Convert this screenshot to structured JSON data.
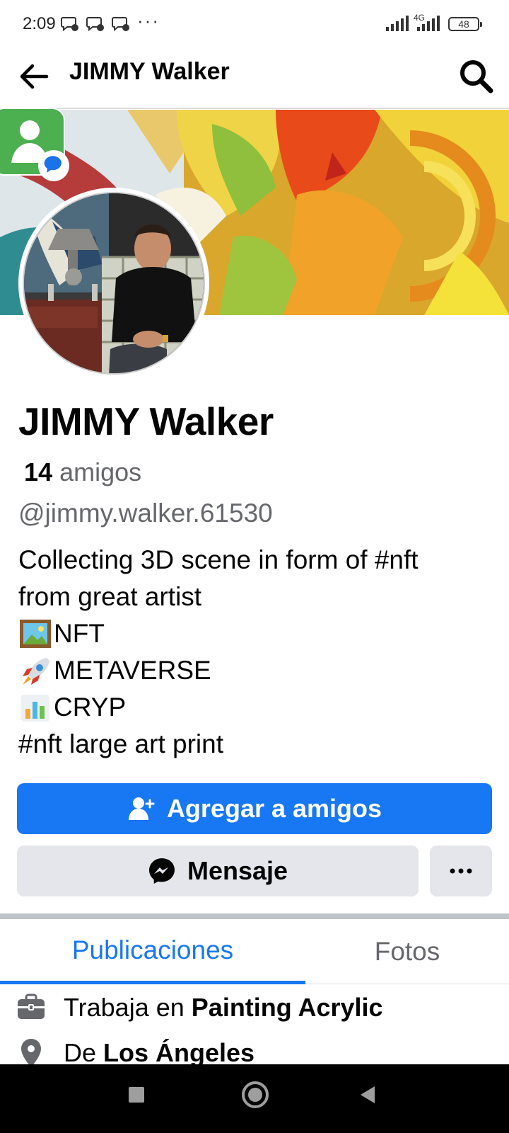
{
  "status_bar": {
    "time": "2:09",
    "dots": "···",
    "network": "4G",
    "battery": "48"
  },
  "header": {
    "title": "JIMMY Walker"
  },
  "profile": {
    "name": "JIMMY Walker",
    "friends_count": "14",
    "friends_label": "amigos",
    "username": "@jimmy.walker.61530",
    "bio": [
      {
        "emoji": "framed-picture-icon",
        "text": "Collecting 3D scene in form of #nft"
      },
      {
        "emoji": "",
        "text": "from great artist"
      },
      {
        "emoji": "framed-picture-icon",
        "text": "NFT"
      },
      {
        "emoji": "rocket-icon",
        "text": "METAVERSE"
      },
      {
        "emoji": "bar-chart-icon",
        "text": "CRYP"
      },
      {
        "emoji": "",
        "text": "#nft large art print"
      }
    ]
  },
  "actions": {
    "add_friend": "Agregar a amigos",
    "message": "Mensaje",
    "more": "···"
  },
  "tabs": [
    {
      "label": "Publicaciones",
      "active": true
    },
    {
      "label": "Fotos",
      "active": false
    }
  ],
  "details": {
    "work_prefix": "Trabaja en",
    "work_place": "Painting Acrylic",
    "from_prefix": "De",
    "from_place": "Los Ángeles"
  },
  "colors": {
    "primary": "#1877f2",
    "secondary_button": "#e4e6eb",
    "muted_text": "#65676b"
  }
}
